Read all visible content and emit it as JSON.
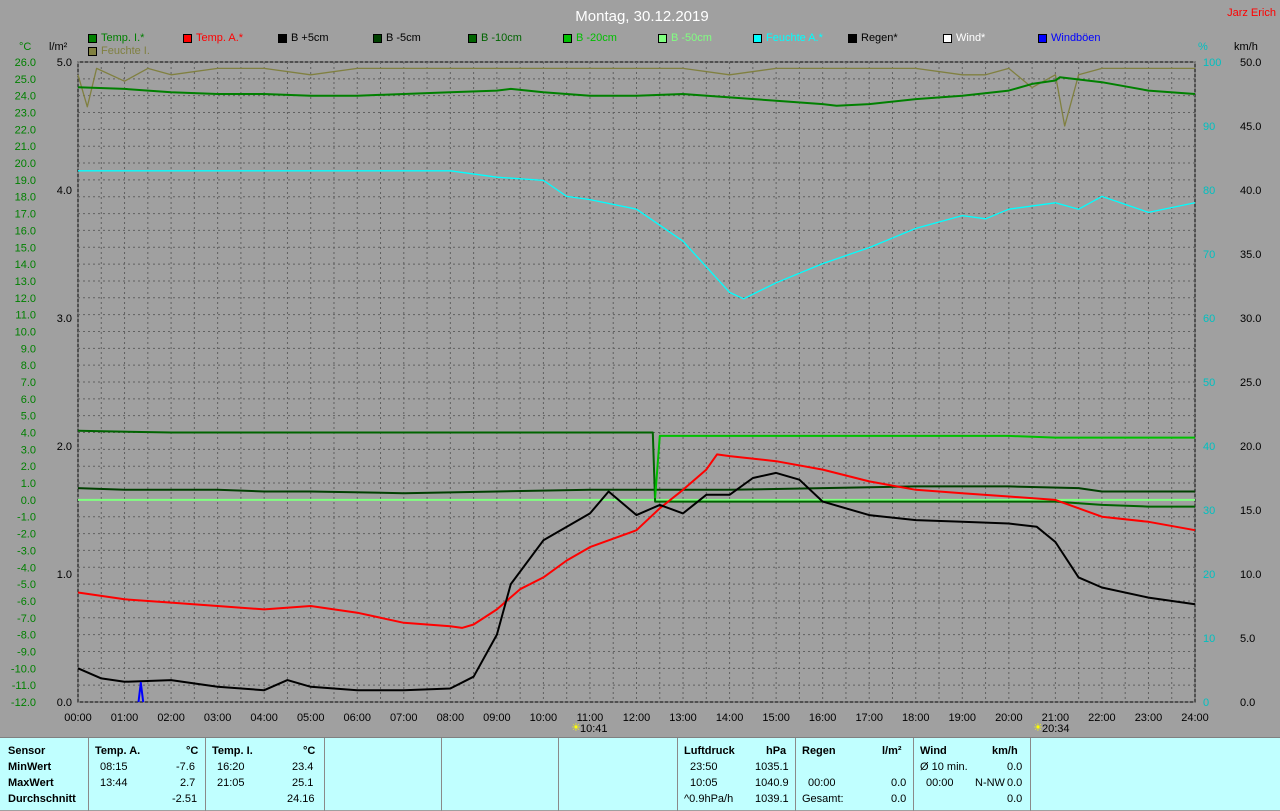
{
  "title": "Montag, 30.12.2019",
  "author": "Jarz Erich",
  "units": {
    "left1": "°C",
    "left2": "l/m²",
    "right1": "%",
    "right2": "km/h"
  },
  "legend": [
    {
      "label": "Temp. I.*",
      "color": "#008000"
    },
    {
      "label": "Temp. A.*",
      "color": "#ff0000"
    },
    {
      "label": "B +5cm",
      "color": "#000000"
    },
    {
      "label": "B -5cm",
      "color": "#004000"
    },
    {
      "label": "B -10cm",
      "color": "#006400"
    },
    {
      "label": "B -20cm",
      "color": "#00c000"
    },
    {
      "label": "B -50cm",
      "color": "#80ff80"
    },
    {
      "label": "Feuchte A.*",
      "color": "#00ffff"
    },
    {
      "label": "Regen*",
      "color": "#000000"
    },
    {
      "label": "Wind*",
      "color": "#ffffff"
    },
    {
      "label": "Windböen",
      "color": "#0000ff"
    },
    {
      "label": "Feuchte I.",
      "color": "#808040"
    }
  ],
  "axes": {
    "temp_ticks": [
      "26.0",
      "25.0",
      "24.0",
      "23.0",
      "22.0",
      "21.0",
      "20.0",
      "19.0",
      "18.0",
      "17.0",
      "16.0",
      "15.0",
      "14.0",
      "13.0",
      "12.0",
      "11.0",
      "10.0",
      "9.0",
      "8.0",
      "7.0",
      "6.0",
      "5.0",
      "4.0",
      "3.0",
      "2.0",
      "1.0",
      "0.0",
      "-1.0",
      "-2.0",
      "-3.0",
      "-4.0",
      "-5.0",
      "-6.0",
      "-7.0",
      "-8.0",
      "-9.0",
      "-10.0",
      "-11.0",
      "-12.0"
    ],
    "rain_ticks": [
      "5.0",
      "4.0",
      "3.0",
      "2.0",
      "1.0",
      "0.0"
    ],
    "humidity_ticks": [
      "100",
      "90",
      "80",
      "70",
      "60",
      "50",
      "40",
      "30",
      "20",
      "10",
      "0"
    ],
    "wind_ticks": [
      "50.0",
      "45.0",
      "40.0",
      "35.0",
      "30.0",
      "25.0",
      "20.0",
      "15.0",
      "10.0",
      "5.0",
      "0.0"
    ],
    "hour_ticks": [
      "00:00",
      "01:00",
      "02:00",
      "03:00",
      "04:00",
      "05:00",
      "06:00",
      "07:00",
      "08:00",
      "09:00",
      "10:00",
      "11:00",
      "12:00",
      "13:00",
      "14:00",
      "15:00",
      "16:00",
      "17:00",
      "18:00",
      "19:00",
      "20:00",
      "21:00",
      "22:00",
      "23:00",
      "24:00"
    ],
    "temp_range": [
      -12,
      26
    ],
    "rain_range": [
      0,
      5
    ],
    "humidity_range": [
      0,
      100
    ],
    "wind_range": [
      0,
      50
    ],
    "x_range_hours": [
      0,
      24
    ]
  },
  "sun": {
    "sunrise": "10:41",
    "sunset": "20:34"
  },
  "chart_data": {
    "type": "line",
    "x_unit": "hour",
    "series": [
      {
        "name": "Temp. I.*",
        "axis": "temp",
        "color": "#008000",
        "points": [
          [
            0,
            24.5
          ],
          [
            1,
            24.4
          ],
          [
            2,
            24.2
          ],
          [
            3,
            24.1
          ],
          [
            4,
            24.1
          ],
          [
            5,
            24.0
          ],
          [
            6,
            24.0
          ],
          [
            7,
            24.1
          ],
          [
            8,
            24.2
          ],
          [
            9,
            24.3
          ],
          [
            9.3,
            24.4
          ],
          [
            10,
            24.2
          ],
          [
            11,
            24.0
          ],
          [
            12,
            24.0
          ],
          [
            13,
            24.1
          ],
          [
            14,
            23.9
          ],
          [
            15,
            23.7
          ],
          [
            16,
            23.5
          ],
          [
            16.3,
            23.4
          ],
          [
            17,
            23.5
          ],
          [
            18,
            23.8
          ],
          [
            19,
            24.0
          ],
          [
            20,
            24.3
          ],
          [
            20.5,
            24.7
          ],
          [
            21,
            24.9
          ],
          [
            21.1,
            25.1
          ],
          [
            22,
            24.8
          ],
          [
            23,
            24.3
          ],
          [
            24,
            24.1
          ]
        ]
      },
      {
        "name": "Temp. A.*",
        "axis": "temp",
        "color": "#ff0000",
        "points": [
          [
            0,
            -5.5
          ],
          [
            1,
            -5.9
          ],
          [
            2,
            -6.1
          ],
          [
            3,
            -6.3
          ],
          [
            4,
            -6.5
          ],
          [
            5,
            -6.3
          ],
          [
            6,
            -6.7
          ],
          [
            7,
            -7.3
          ],
          [
            8,
            -7.5
          ],
          [
            8.25,
            -7.6
          ],
          [
            8.5,
            -7.4
          ],
          [
            9,
            -6.5
          ],
          [
            9.5,
            -5.3
          ],
          [
            10,
            -4.6
          ],
          [
            10.5,
            -3.6
          ],
          [
            11,
            -2.8
          ],
          [
            12,
            -1.8
          ],
          [
            12.5,
            -0.5
          ],
          [
            13,
            0.6
          ],
          [
            13.5,
            1.8
          ],
          [
            13.73,
            2.7
          ],
          [
            14,
            2.6
          ],
          [
            15,
            2.3
          ],
          [
            16,
            1.8
          ],
          [
            17,
            1.1
          ],
          [
            18,
            0.6
          ],
          [
            19,
            0.4
          ],
          [
            20,
            0.2
          ],
          [
            21,
            0.0
          ],
          [
            22,
            -1.0
          ],
          [
            23,
            -1.3
          ],
          [
            24,
            -1.8
          ]
        ]
      },
      {
        "name": "B +5cm",
        "axis": "temp",
        "color": "#000000",
        "points": [
          [
            0,
            -10.0
          ],
          [
            0.5,
            -10.6
          ],
          [
            1,
            -10.8
          ],
          [
            2,
            -10.7
          ],
          [
            3,
            -11.1
          ],
          [
            4,
            -11.3
          ],
          [
            4.5,
            -10.7
          ],
          [
            5,
            -11.1
          ],
          [
            6,
            -11.3
          ],
          [
            7,
            -11.3
          ],
          [
            8,
            -11.2
          ],
          [
            8.5,
            -10.5
          ],
          [
            9,
            -8.0
          ],
          [
            9.3,
            -5.0
          ],
          [
            10,
            -2.4
          ],
          [
            11,
            -0.8
          ],
          [
            11.4,
            0.5
          ],
          [
            12,
            -0.9
          ],
          [
            12.5,
            -0.3
          ],
          [
            13,
            -0.8
          ],
          [
            13.5,
            0.3
          ],
          [
            14,
            0.3
          ],
          [
            14.5,
            1.3
          ],
          [
            15,
            1.6
          ],
          [
            15.5,
            1.2
          ],
          [
            16,
            -0.1
          ],
          [
            17,
            -0.9
          ],
          [
            18,
            -1.2
          ],
          [
            19,
            -1.3
          ],
          [
            20,
            -1.4
          ],
          [
            20.6,
            -1.6
          ],
          [
            21,
            -2.5
          ],
          [
            21.5,
            -4.6
          ],
          [
            22,
            -5.2
          ],
          [
            23,
            -5.8
          ],
          [
            24,
            -6.2
          ]
        ]
      },
      {
        "name": "B -5cm",
        "axis": "temp",
        "color": "#004000",
        "points": [
          [
            0,
            0.7
          ],
          [
            1,
            0.6
          ],
          [
            2,
            0.6
          ],
          [
            3,
            0.6
          ],
          [
            4,
            0.5
          ],
          [
            5,
            0.5
          ],
          [
            7,
            0.4
          ],
          [
            9,
            0.5
          ],
          [
            11,
            0.6
          ],
          [
            12.4,
            0.6
          ],
          [
            13,
            0.6
          ],
          [
            14,
            0.6
          ],
          [
            16,
            0.7
          ],
          [
            18,
            0.8
          ],
          [
            20,
            0.8
          ],
          [
            21.5,
            0.7
          ],
          [
            22,
            0.5
          ],
          [
            23,
            0.5
          ],
          [
            24,
            0.5
          ]
        ]
      },
      {
        "name": "B -10cm",
        "axis": "temp",
        "color": "#006400",
        "points": [
          [
            0,
            4.1
          ],
          [
            2,
            4.0
          ],
          [
            4,
            4.0
          ],
          [
            6,
            4.0
          ],
          [
            8,
            4.0
          ],
          [
            10,
            4.0
          ],
          [
            12.35,
            4.0
          ],
          [
            12.4,
            -0.1
          ],
          [
            13,
            -0.1
          ],
          [
            16,
            -0.1
          ],
          [
            19,
            -0.1
          ],
          [
            21,
            -0.1
          ],
          [
            22,
            -0.3
          ],
          [
            23,
            -0.4
          ],
          [
            24,
            -0.4
          ]
        ]
      },
      {
        "name": "B -20cm",
        "axis": "temp",
        "color": "#00c000",
        "points": [
          [
            12.4,
            0.1
          ],
          [
            12.5,
            3.8
          ],
          [
            14,
            3.8
          ],
          [
            16,
            3.8
          ],
          [
            18,
            3.8
          ],
          [
            20,
            3.8
          ],
          [
            21,
            3.7
          ],
          [
            22,
            3.7
          ],
          [
            24,
            3.7
          ]
        ]
      },
      {
        "name": "B -50cm",
        "axis": "temp",
        "color": "#80ff80",
        "points": [
          [
            0,
            0.0
          ],
          [
            24,
            0.0
          ]
        ]
      },
      {
        "name": "Feuchte A.*",
        "axis": "humidity",
        "color": "#00ffff",
        "points": [
          [
            0,
            83
          ],
          [
            5,
            83
          ],
          [
            8,
            83
          ],
          [
            9,
            82
          ],
          [
            10,
            81.5
          ],
          [
            10.5,
            79
          ],
          [
            11,
            78.5
          ],
          [
            12,
            77
          ],
          [
            13,
            72
          ],
          [
            14,
            64
          ],
          [
            14.3,
            63
          ],
          [
            15,
            65.5
          ],
          [
            16,
            68.5
          ],
          [
            17,
            71
          ],
          [
            18,
            74
          ],
          [
            19,
            76
          ],
          [
            19.5,
            75.5
          ],
          [
            20,
            77
          ],
          [
            21,
            78
          ],
          [
            21.5,
            77
          ],
          [
            22,
            79
          ],
          [
            23,
            76.5
          ],
          [
            24,
            78
          ]
        ]
      },
      {
        "name": "Feuchte I.",
        "axis": "humidity",
        "color": "#808040",
        "points": [
          [
            0,
            98
          ],
          [
            0.2,
            93
          ],
          [
            0.4,
            99
          ],
          [
            1,
            97
          ],
          [
            1.5,
            99
          ],
          [
            2,
            98
          ],
          [
            3,
            99
          ],
          [
            4,
            99
          ],
          [
            5,
            98
          ],
          [
            6,
            99
          ],
          [
            8,
            99
          ],
          [
            10,
            99
          ],
          [
            11,
            99
          ],
          [
            13,
            99
          ],
          [
            14,
            98
          ],
          [
            15,
            99
          ],
          [
            16,
            99
          ],
          [
            17,
            99
          ],
          [
            18,
            99
          ],
          [
            19,
            98
          ],
          [
            19.5,
            98
          ],
          [
            20,
            99
          ],
          [
            20.5,
            96
          ],
          [
            21,
            98
          ],
          [
            21.2,
            90
          ],
          [
            21.5,
            98
          ],
          [
            22,
            99
          ],
          [
            23,
            99
          ],
          [
            24,
            99
          ]
        ]
      },
      {
        "name": "Windböen",
        "axis": "wind",
        "color": "#0000ff",
        "points": [
          [
            1.3,
            0
          ],
          [
            1.35,
            1.5
          ],
          [
            1.4,
            0
          ]
        ]
      }
    ]
  },
  "footer": {
    "col1": {
      "header": "Sensor",
      "rows": [
        "MinWert",
        "MaxWert",
        "Durchschnitt"
      ]
    },
    "col2": {
      "header": "Temp. A.",
      "unit": "°C",
      "times": [
        "08:15",
        "13:44",
        ""
      ],
      "values": [
        "-7.6",
        "2.7",
        "-2.51"
      ]
    },
    "col3": {
      "header": "Temp. I.",
      "unit": "°C",
      "times": [
        "16:20",
        "21:05",
        ""
      ],
      "values": [
        "23.4",
        "25.1",
        "24.16"
      ]
    },
    "pressure": {
      "header": "Luftdruck",
      "unit": "hPa",
      "times": [
        "23:50",
        "10:05",
        "^0.9hPa/h"
      ],
      "values": [
        "1035.1",
        "1040.9",
        "1039.1"
      ]
    },
    "rain": {
      "header": "Regen",
      "unit": "l/m²",
      "times": [
        "",
        "00:00",
        "Gesamt:"
      ],
      "values": [
        "",
        "0.0",
        "0.0"
      ]
    },
    "wind": {
      "header": "Wind",
      "unit": "km/h",
      "times": [
        "Ø 10 min.",
        "00:00",
        ""
      ],
      "dirs": [
        "",
        "N-NW",
        ""
      ],
      "values": [
        "0.0",
        "0.0",
        "0.0"
      ]
    }
  }
}
